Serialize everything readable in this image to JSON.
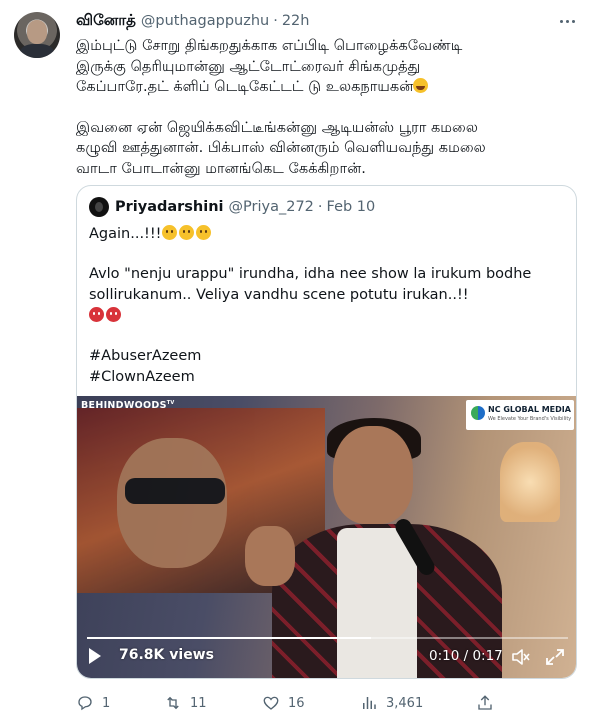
{
  "tweet": {
    "author_name": "வினோத்",
    "author_handle": "@puthagappuzhu",
    "separator": "·",
    "time": "22h",
    "text_lines": [
      "இம்புட்டு சோறு திங்கறதுக்காக எப்பிடி பொழைக்கவேண்டி",
      "இருக்கு தெரியுமான்னு ஆட்டோட்ரைவர் சிங்கமுத்து",
      "கேப்பாரே.தட் க்ளிப் டெடிகேட்டட் டு உலகநாயகன்"
    ],
    "text_lines_2": [
      "இவனை ஏன் ஜெயிக்கவிட்டீங்கன்னு ஆடியன்ஸ் பூரா கமலை",
      "கழுவி ஊத்துனான். பிக்பாஸ் வின்னரும் வெளியவந்து கமலை",
      "வாடா போடான்னு மானங்கெட கேக்கிறான்."
    ]
  },
  "quote": {
    "author_name": "Priyadarshini",
    "author_handle": "@Priya_272",
    "separator": "·",
    "date": "Feb 10",
    "line1": "Again...!!!",
    "line2": "Avlo \"nenju urappu\" irundha, idha nee show la irukum bodhe",
    "line3": "sollirukanum.. Veliya vandhu scene potutu irukan..!!",
    "hashtag1": "#AbuserAzeem",
    "hashtag2": "#ClownAzeem"
  },
  "video": {
    "channel_logo": "BEHINDWOODS",
    "channel_sup": "TV",
    "watermark_title": "NC GLOBAL MEDIA",
    "watermark_sub": "We Elevate Your Brand's Visibility",
    "views": "76.8K views",
    "time_display": "0:10 / 0:17",
    "progress": 0.59
  },
  "actions": {
    "replies": "1",
    "retweets": "11",
    "likes": "16",
    "views": "3,461"
  },
  "icons": {
    "more": "more-icon",
    "reply": "reply-icon",
    "retweet": "retweet-icon",
    "like": "heart-icon",
    "views": "views-icon",
    "share": "share-icon",
    "play": "play-icon",
    "mute": "mute-icon",
    "expand": "expand-icon"
  },
  "colors": {
    "text": "#0f1419",
    "secondary": "#536471",
    "border": "#cfd9de"
  }
}
